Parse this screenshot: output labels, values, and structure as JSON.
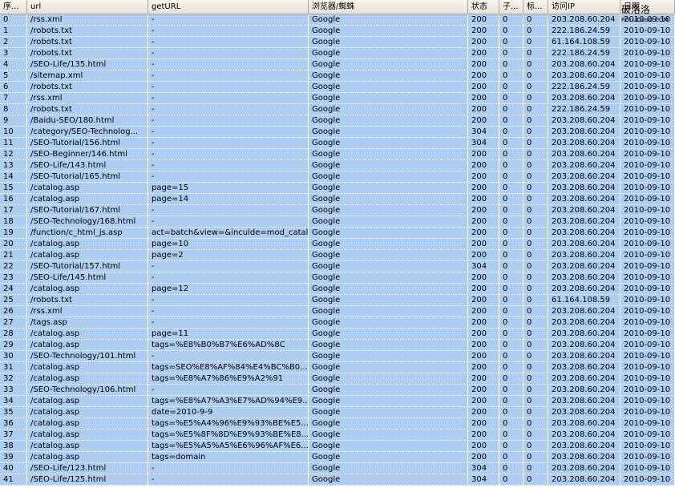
{
  "columns": [
    "序...",
    "url",
    "getURL",
    "浏览器/蜘蛛",
    "状态",
    "子...",
    "标...",
    "访问IP",
    "日期"
  ],
  "watermark": {
    "main": "破洛洛",
    "sub": "POLUOLUO.COM"
  },
  "rows": [
    [
      "0",
      "/rss.xml",
      "-",
      "Google",
      "200",
      "0",
      "0",
      "203.208.60.204",
      "2010-09-10"
    ],
    [
      "1",
      "/robots.txt",
      "-",
      "Google",
      "200",
      "0",
      "0",
      "222.186.24.59",
      "2010-09-10"
    ],
    [
      "2",
      "/robots.txt",
      "-",
      "Google",
      "200",
      "0",
      "0",
      "61.164.108.59",
      "2010-09-10"
    ],
    [
      "3",
      "/robots.txt",
      "-",
      "Google",
      "200",
      "0",
      "0",
      "222.186.24.59",
      "2010-09-10"
    ],
    [
      "4",
      "/SEO-Life/135.html",
      "-",
      "Google",
      "200",
      "0",
      "0",
      "203.208.60.204",
      "2010-09-10"
    ],
    [
      "5",
      "/sitemap.xml",
      "-",
      "Google",
      "200",
      "0",
      "0",
      "203.208.60.204",
      "2010-09-10"
    ],
    [
      "6",
      "/robots.txt",
      "-",
      "Google",
      "200",
      "0",
      "0",
      "222.186.24.59",
      "2010-09-10"
    ],
    [
      "7",
      "/rss.xml",
      "-",
      "Google",
      "200",
      "0",
      "0",
      "203.208.60.204",
      "2010-09-10"
    ],
    [
      "8",
      "/robots.txt",
      "-",
      "Google",
      "200",
      "0",
      "0",
      "222.186.24.59",
      "2010-09-10"
    ],
    [
      "9",
      "/Baidu-SEO/180.html",
      "-",
      "Google",
      "200",
      "0",
      "0",
      "203.208.60.204",
      "2010-09-10"
    ],
    [
      "10",
      "/category/SEO-Technolog...",
      "-",
      "Google",
      "304",
      "0",
      "0",
      "203.208.60.204",
      "2010-09-10"
    ],
    [
      "11",
      "/SEO-Tutorial/156.html",
      "-",
      "Google",
      "304",
      "0",
      "0",
      "203.208.60.204",
      "2010-09-10"
    ],
    [
      "12",
      "/SEO-Beginner/146.html",
      "-",
      "Google",
      "200",
      "0",
      "0",
      "203.208.60.204",
      "2010-09-10"
    ],
    [
      "13",
      "/SEO-Life/143.html",
      "-",
      "Google",
      "200",
      "0",
      "0",
      "203.208.60.204",
      "2010-09-10"
    ],
    [
      "14",
      "/SEO-Tutorial/165.html",
      "-",
      "Google",
      "200",
      "0",
      "0",
      "203.208.60.204",
      "2010-09-10"
    ],
    [
      "15",
      "/catalog.asp",
      "page=15",
      "Google",
      "200",
      "0",
      "0",
      "203.208.60.204",
      "2010-09-10"
    ],
    [
      "16",
      "/catalog.asp",
      "page=14",
      "Google",
      "200",
      "0",
      "0",
      "203.208.60.204",
      "2010-09-10"
    ],
    [
      "17",
      "/SEO-Tutorial/167.html",
      "-",
      "Google",
      "200",
      "0",
      "0",
      "203.208.60.204",
      "2010-09-10"
    ],
    [
      "18",
      "/SEO-Technology/168.html",
      "-",
      "Google",
      "200",
      "0",
      "0",
      "203.208.60.204",
      "2010-09-10"
    ],
    [
      "19",
      "/function/c_html_js.asp",
      "act=batch&view=&inculde=mod_catal...",
      "Google",
      "200",
      "0",
      "0",
      "203.208.60.204",
      "2010-09-10"
    ],
    [
      "20",
      "/catalog.asp",
      "page=10",
      "Google",
      "200",
      "0",
      "0",
      "203.208.60.204",
      "2010-09-10"
    ],
    [
      "21",
      "/catalog.asp",
      "page=2",
      "Google",
      "200",
      "0",
      "0",
      "203.208.60.204",
      "2010-09-10"
    ],
    [
      "22",
      "/SEO-Tutorial/157.html",
      "-",
      "Google",
      "304",
      "0",
      "0",
      "203.208.60.204",
      "2010-09-10"
    ],
    [
      "23",
      "/SEO-Life/145.html",
      "-",
      "Google",
      "200",
      "0",
      "0",
      "203.208.60.204",
      "2010-09-10"
    ],
    [
      "24",
      "/catalog.asp",
      "page=12",
      "Google",
      "200",
      "0",
      "0",
      "203.208.60.204",
      "2010-09-10"
    ],
    [
      "25",
      "/robots.txt",
      "-",
      "Google",
      "200",
      "0",
      "0",
      "61.164.108.59",
      "2010-09-10"
    ],
    [
      "26",
      "/rss.xml",
      "-",
      "Google",
      "200",
      "0",
      "0",
      "203.208.60.204",
      "2010-09-10"
    ],
    [
      "27",
      "/tags.asp",
      "-",
      "Google",
      "200",
      "0",
      "0",
      "203.208.60.204",
      "2010-09-10"
    ],
    [
      "28",
      "/catalog.asp",
      "page=11",
      "Google",
      "200",
      "0",
      "0",
      "203.208.60.204",
      "2010-09-10"
    ],
    [
      "29",
      "/catalog.asp",
      "tags=%E8%B0%B7%E6%AD%8C",
      "Google",
      "200",
      "0",
      "0",
      "203.208.60.204",
      "2010-09-10"
    ],
    [
      "30",
      "/SEO-Technology/101.html",
      "-",
      "Google",
      "200",
      "0",
      "0",
      "203.208.60.204",
      "2010-09-10"
    ],
    [
      "31",
      "/catalog.asp",
      "tags=SEO%E8%AF%84%E4%BC%B0...",
      "Google",
      "200",
      "0",
      "0",
      "203.208.60.204",
      "2010-09-10"
    ],
    [
      "32",
      "/catalog.asp",
      "tags=%E8%A7%86%E9%A2%91",
      "Google",
      "200",
      "0",
      "0",
      "203.208.60.204",
      "2010-09-10"
    ],
    [
      "33",
      "/SEO-Technology/106.html",
      "-",
      "Google",
      "200",
      "0",
      "0",
      "203.208.60.204",
      "2010-09-10"
    ],
    [
      "34",
      "/catalog.asp",
      "tags=%E8%A7%A3%E7%AD%94%E9...",
      "Google",
      "200",
      "0",
      "0",
      "203.208.60.204",
      "2010-09-10"
    ],
    [
      "35",
      "/catalog.asp",
      "date=2010-9-9",
      "Google",
      "200",
      "0",
      "0",
      "203.208.60.204",
      "2010-09-10"
    ],
    [
      "36",
      "/catalog.asp",
      "tags=%E5%A4%96%E9%93%BE%E5...",
      "Google",
      "200",
      "0",
      "0",
      "203.208.60.204",
      "2010-09-10"
    ],
    [
      "37",
      "/catalog.asp",
      "tags=%E5%8F%8D%E9%93%BE%E8...",
      "Google",
      "200",
      "0",
      "0",
      "203.208.60.204",
      "2010-09-10"
    ],
    [
      "38",
      "/catalog.asp",
      "tags=%E5%A5%A5%E6%96%AF%E6...",
      "Google",
      "200",
      "0",
      "0",
      "203.208.60.204",
      "2010-09-10"
    ],
    [
      "39",
      "/catalog.asp",
      "tags=domain",
      "Google",
      "200",
      "0",
      "0",
      "203.208.60.204",
      "2010-09-10"
    ],
    [
      "40",
      "/SEO-Life/123.html",
      "-",
      "Google",
      "304",
      "0",
      "0",
      "203.208.60.204",
      "2010-09-10"
    ],
    [
      "41",
      "/SEO-Life/125.html",
      "-",
      "Google",
      "304",
      "0",
      "0",
      "203.208.60.204",
      "2010-09-10"
    ]
  ]
}
